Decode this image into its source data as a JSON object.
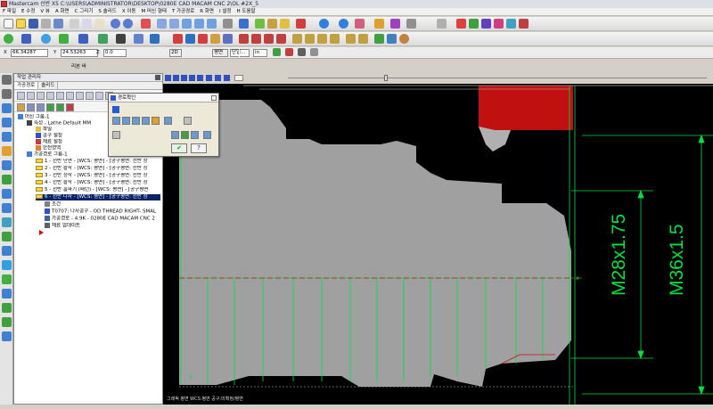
{
  "window": {
    "title": "Mastercam 선반 X5   C:\\USERS\\ADMINISTRATOR\\DESKTOP\\0280E CAD MACAM CNC 2\\OL #2X_5"
  },
  "menu": [
    "F 파일",
    "E 수정",
    "V 뷰",
    "A 화면",
    "C 그리기",
    "S 솔리드",
    "X 이동",
    "M 머신 형태",
    "T 가공경로",
    "R 화면",
    "I 설정",
    "H 도움말"
  ],
  "coords": {
    "x": "66.34287",
    "y": "24.53263",
    "z": "0.0",
    "mode": "2D",
    "view": "단일...",
    "unit": "in",
    "plane": "평면"
  },
  "subbar": {
    "label": "리본 바"
  },
  "panel": {
    "title": "작업 관리자",
    "tabs": [
      "가공경로",
      "솔리드"
    ],
    "tree": [
      {
        "text": "머신 그룹-1",
        "level": 0,
        "kind": "machine"
      },
      {
        "text": "속성 - Lathe Default MM",
        "level": 1,
        "kind": "prop"
      },
      {
        "text": "파일",
        "level": 2,
        "kind": "file"
      },
      {
        "text": "공구 설정",
        "level": 2,
        "kind": "tool"
      },
      {
        "text": "재료 설정",
        "level": 2,
        "kind": "stock"
      },
      {
        "text": "안전영역",
        "level": 2,
        "kind": "safety"
      },
      {
        "text": "가공경로 그룹-1",
        "level": 1,
        "kind": "group"
      },
      {
        "text": "1 - 선반 단면 - [WCS: 평면] - [공구평면: 선반 상",
        "level": 2,
        "kind": "op"
      },
      {
        "text": "2 - 선반 황삭 - [WCS: 평면] - [공구평면: 선반 상",
        "level": 2,
        "kind": "op"
      },
      {
        "text": "3 - 선반 정삭 - [WCS: 평면] - [공구평면: 선반 상",
        "level": 2,
        "kind": "op"
      },
      {
        "text": "4 - 선반 황삭 - [WCS: 평면] - [공구평면: 선반 상",
        "level": 2,
        "kind": "op"
      },
      {
        "text": "5 - 선반 홈파기 (패턴) - [WCS: 평면] - [공구평면",
        "level": 2,
        "kind": "op"
      },
      {
        "text": "6 - 선반 나사 - [WCS: 평면] - [공구평면: 선반 상",
        "level": 2,
        "kind": "op-selected"
      },
      {
        "text": "조건",
        "level": 3,
        "kind": "param"
      },
      {
        "text": "T0707: 나사공구 - OD THREAD RIGHT- SMAL",
        "level": 3,
        "kind": "toolitem"
      },
      {
        "text": "가공경로 - 4.9K - 0280E CAD MACAM CNC 2",
        "level": 3,
        "kind": "path"
      },
      {
        "text": "재료 업데이트",
        "level": 3,
        "kind": "update"
      }
    ]
  },
  "dialog": {
    "title": "경로확인",
    "ok": "확인",
    "help": "도움말"
  },
  "viewport": {
    "label_left": "M28x1.75",
    "label_right": "M36x1.5",
    "footer": "그래픽 평면   WCS:평면   공구:미확정/평면"
  },
  "colors": {
    "part": "#a0a0a0",
    "wire": "#00e040",
    "red": "#c01010",
    "selected": "#0a246a"
  }
}
